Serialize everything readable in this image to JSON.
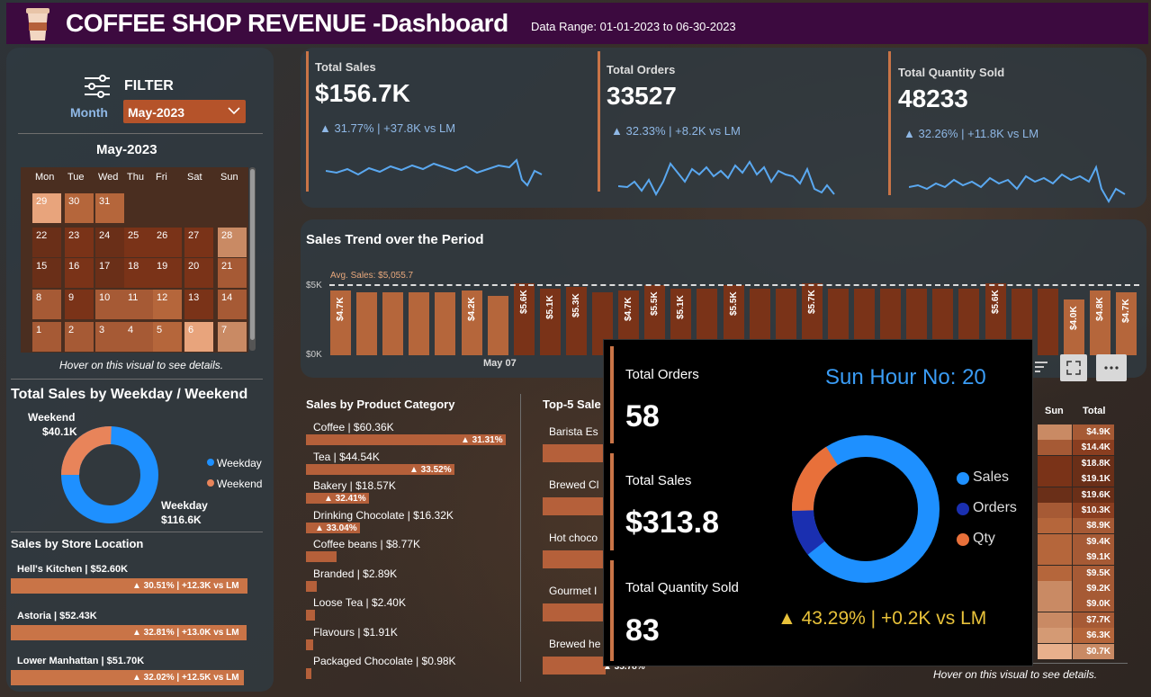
{
  "header": {
    "title": "COFFEE SHOP REVENUE -Dashboard",
    "date_range": "Data Range: 01-01-2023 to 06-30-2023"
  },
  "filter": {
    "title": "FILTER",
    "month_label": "Month",
    "month_value": "May-2023"
  },
  "calendar": {
    "title": "May-2023",
    "weekdays": [
      "Mon",
      "Tue",
      "Wed",
      "Thu",
      "Fri",
      "Sat",
      "Sun"
    ],
    "rows": [
      [
        "29",
        "30",
        "31",
        "",
        "",
        "",
        ""
      ],
      [
        "22",
        "23",
        "24",
        "25",
        "26",
        "27",
        "28"
      ],
      [
        "15",
        "16",
        "17",
        "18",
        "19",
        "20",
        "21"
      ],
      [
        "8",
        "9",
        "10",
        "11",
        "12",
        "13",
        "14"
      ],
      [
        "1",
        "2",
        "3",
        "4",
        "5",
        "6",
        "7"
      ]
    ],
    "hint": "Hover on this visual to see details."
  },
  "weekday_chart": {
    "title": "Total Sales by Weekday / Weekend",
    "weekend_label": "Weekend",
    "weekend_value": "$40.1K",
    "weekday_label": "Weekday",
    "weekday_value": "$116.6K",
    "legend": [
      "Weekday",
      "Weekend"
    ],
    "colors": {
      "weekday": "#1e90ff",
      "weekend": "#e8845a"
    }
  },
  "store": {
    "title": "Sales by Store Location",
    "items": [
      {
        "label": "Hell's Kitchen | $52.60K",
        "delta": "▲ 30.51% | +12.3K vs LM"
      },
      {
        "label": "Astoria | $52.43K",
        "delta": "▲ 32.81% | +13.0K vs LM"
      },
      {
        "label": "Lower Manhattan | $51.70K",
        "delta": "▲ 32.02% | +12.5K vs LM"
      }
    ]
  },
  "kpis": [
    {
      "title": "Total Sales",
      "value": "$156.7K",
      "delta": "▲ 31.77% | +37.8K vs LM"
    },
    {
      "title": "Total Orders",
      "value": "33527",
      "delta": "▲ 32.33% | +8.2K vs LM"
    },
    {
      "title": "Total Quantity Sold",
      "value": "48233",
      "delta": "▲ 32.26% | +11.8K vs LM"
    }
  ],
  "trend": {
    "title": "Sales Trend over the Period",
    "avg_label": "Avg. Sales: $5,055.7",
    "y_top": "$5K",
    "y_bottom": "$0K",
    "x_label": "May 07",
    "bar_labels": [
      "$4.7K",
      "",
      "",
      "",
      "",
      "$4.2K",
      "",
      "$5.6K",
      "$5.1K",
      "$5.3K",
      "",
      "$4.7K",
      "$5.5K",
      "$5.1K",
      "",
      "$5.5K",
      "",
      "",
      "$5.7K",
      "",
      "",
      "",
      "",
      "",
      "",
      "$5.6K",
      "",
      "",
      "$4.0K",
      "$4.8K",
      "$4.7K"
    ]
  },
  "category": {
    "title": "Sales by Product Category",
    "items": [
      {
        "label": "Coffee | $60.36K",
        "delta": "▲ 31.31%"
      },
      {
        "label": "Tea | $44.54K",
        "delta": "▲ 33.52%"
      },
      {
        "label": "Bakery | $18.57K",
        "delta": "▲ 32.41%"
      },
      {
        "label": "Drinking Chocolate | $16.32K",
        "delta": "▲ 33.04%"
      },
      {
        "label": "Coffee beans | $8.77K",
        "delta": ""
      },
      {
        "label": "Branded | $2.89K",
        "delta": ""
      },
      {
        "label": "Loose Tea | $2.40K",
        "delta": ""
      },
      {
        "label": "Flavours | $1.91K",
        "delta": ""
      },
      {
        "label": "Packaged Chocolate | $0.98K",
        "delta": ""
      }
    ]
  },
  "top5": {
    "title": "Top-5 Sale",
    "items": [
      "Barista Es",
      "Brewed Cl",
      "Hot choco",
      "Gourmet I",
      "Brewed he"
    ],
    "last_delta": "▲ 35.78%"
  },
  "heatmap": {
    "col_sun": "Sun",
    "col_total": "Total",
    "totals": [
      "$4.9K",
      "$14.4K",
      "$18.8K",
      "$19.1K",
      "$19.6K",
      "$10.3K",
      "$8.9K",
      "$9.4K",
      "$9.1K",
      "$9.5K",
      "$9.2K",
      "$9.0K",
      "$7.7K",
      "$6.3K",
      "$0.7K"
    ],
    "hint": "Hover on this visual to see details."
  },
  "tooltip": {
    "orders_label": "Total Orders",
    "orders_value": "58",
    "sales_label": "Total Sales",
    "sales_value": "$313.8",
    "qty_label": "Total Quantity Sold",
    "qty_value": "83",
    "header": "Sun  Hour No: 20",
    "delta": "▲ 43.29% | +0.2K vs LM",
    "legend": [
      "Sales",
      "Orders",
      "Qty"
    ],
    "colors": {
      "sales": "#1e90ff",
      "orders": "#1a2fb0",
      "qty": "#e8703a"
    }
  }
}
